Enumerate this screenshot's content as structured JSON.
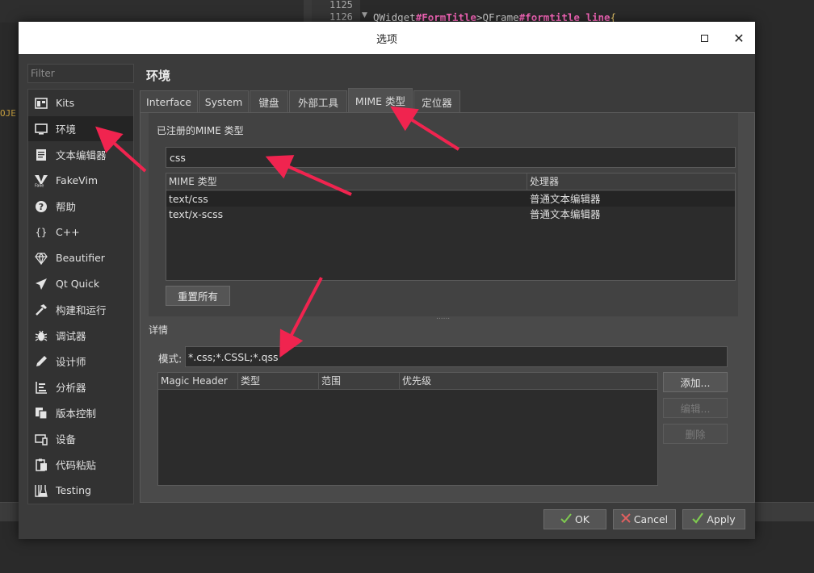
{
  "editor": {
    "line_numbers": [
      "1125",
      "1126"
    ],
    "code": {
      "part1": "QWidget",
      "part2": "#FormTitle",
      "part3": ">QFrame",
      "part4": "#formtitle_line",
      "part5": "{"
    },
    "side_text": "OJE"
  },
  "dialog": {
    "title": "选项",
    "filter_placeholder": "Filter",
    "categories": [
      {
        "label": "Kits",
        "icon": "kits-icon"
      },
      {
        "label": "环境",
        "icon": "monitor-icon"
      },
      {
        "label": "文本编辑器",
        "icon": "text-editor-icon"
      },
      {
        "label": "FakeVim",
        "icon": "fakevim-icon"
      },
      {
        "label": "帮助",
        "icon": "help-icon"
      },
      {
        "label": "C++",
        "icon": "braces-icon"
      },
      {
        "label": "Beautifier",
        "icon": "diamond-icon"
      },
      {
        "label": "Qt Quick",
        "icon": "paper-plane-icon"
      },
      {
        "label": "构建和运行",
        "icon": "hammer-icon"
      },
      {
        "label": "调试器",
        "icon": "bug-icon"
      },
      {
        "label": "设计师",
        "icon": "pencil-icon"
      },
      {
        "label": "分析器",
        "icon": "analyzer-icon"
      },
      {
        "label": "版本控制",
        "icon": "version-control-icon"
      },
      {
        "label": "设备",
        "icon": "device-icon"
      },
      {
        "label": "代码粘贴",
        "icon": "clipboard-icon"
      },
      {
        "label": "Testing",
        "icon": "flask-icon"
      }
    ],
    "selected_category": "环境",
    "section_title": "环境",
    "tabs": [
      "Interface",
      "System",
      "键盘",
      "外部工具",
      "MIME 类型",
      "定位器"
    ],
    "active_tab": "MIME 类型",
    "registered": {
      "title": "已注册的MIME 类型",
      "filter_value": "css",
      "columns": [
        "MIME 类型",
        "处理器"
      ],
      "rows": [
        {
          "type": "text/css",
          "handler": "普通文本编辑器"
        },
        {
          "type": "text/x-scss",
          "handler": "普通文本编辑器"
        }
      ],
      "reset_label": "重置所有"
    },
    "splitter_handle": "......",
    "details": {
      "title": "详情",
      "pattern_label": "模式:",
      "pattern_value": "*.css;*.CSSL;*.qss",
      "columns": [
        "Magic Header",
        "类型",
        "范围",
        "优先级"
      ],
      "add_label": "添加...",
      "edit_label": "编辑...",
      "remove_label": "删除"
    },
    "buttons": {
      "ok": "OK",
      "cancel": "Cancel",
      "apply": "Apply"
    },
    "colors": {
      "arrow": "#f0244f",
      "ok_icon": "#7ec850",
      "cancel_icon": "#e06060",
      "apply_icon": "#7ec850"
    }
  }
}
